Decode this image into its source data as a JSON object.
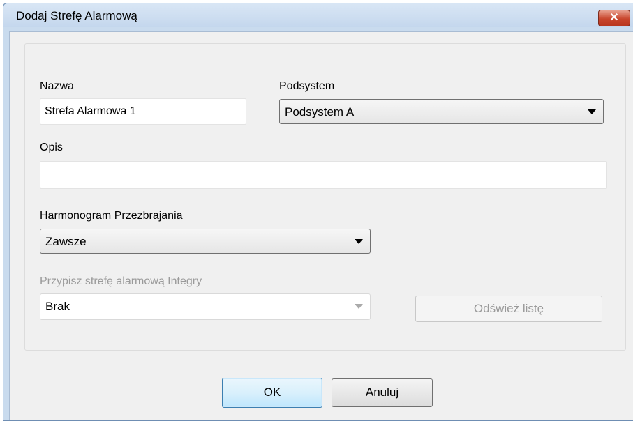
{
  "window": {
    "title": "Dodaj Strefę Alarmową",
    "close_glyph": "✕"
  },
  "form": {
    "name_label": "Nazwa",
    "name_value": "Strefa Alarmowa 1",
    "subsystem_label": "Podsystem",
    "subsystem_selected": "Podsystem A",
    "description_label": "Opis",
    "description_value": "",
    "schedule_label": "Harmonogram Przezbrajania",
    "schedule_selected": "Zawsze",
    "integra_label": "Przypisz strefę alarmową Integry",
    "integra_selected": "Brak",
    "refresh_label": "Odśwież listę"
  },
  "footer": {
    "ok_label": "OK",
    "cancel_label": "Anuluj"
  },
  "icons": {
    "close": "close-icon",
    "dropdown": "chevron-down-icon"
  }
}
